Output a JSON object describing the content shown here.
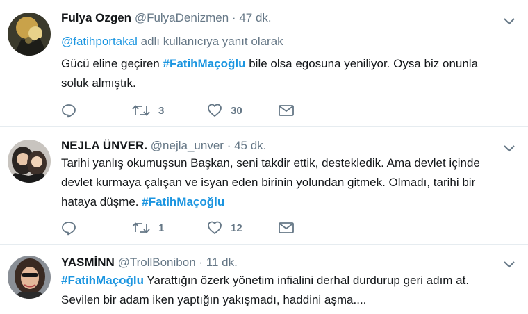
{
  "tweets": [
    {
      "name": "Fulya Ozgen",
      "handle": "@FulyaDenizmen",
      "separator": "·",
      "time": "47 dk.",
      "reply_mention": "@fatihportakal",
      "reply_suffix": "adlı kullanıcıya yanıt olarak",
      "line1_pre": "Gücü eline geçiren ",
      "line1_hashtag": "#FatihMaçoğlu",
      "line1_post": " bile olsa egosuna yeniliyor. Oysa biz onunla",
      "line2": "soluk almıştık.",
      "retweets": "3",
      "likes": "30",
      "avatar_icon": "user-avatar"
    },
    {
      "name": "NEJLA ÜNVER.",
      "handle": "@nejla_unver",
      "separator": "·",
      "time": "45 dk.",
      "line1": "Tarihi yanlış okumuşsun Başkan, seni takdir ettik, destekledik. Ama devlet içinde",
      "line2": "devlet kurmaya çalışan ve isyan eden birinin yolundan gitmek. Olmadı, tarihi bir",
      "line3_pre": "hataya düşme. ",
      "line3_hashtag": "#FatihMaçoğlu",
      "retweets": "1",
      "likes": "12",
      "avatar_icon": "user-avatar"
    },
    {
      "name": "YASMİNN",
      "handle": "@TrollBonibon",
      "separator": "·",
      "time": "11 dk.",
      "line1_hashtag": "#FatihMaçoğlu",
      "line1_post": " Yarattığın özerk yönetim infialini derhal durdurup geri adım at.",
      "line2": "Sevilen bir adam iken yaptığın yakışmadı, haddini aşma....",
      "avatar_icon": "user-avatar"
    }
  ],
  "colors": {
    "link": "#1b95e0",
    "muted": "#657786",
    "text": "#14171a",
    "divider": "#e6ecf0"
  },
  "icons": [
    "reply-icon",
    "retweet-icon",
    "like-icon",
    "message-icon",
    "chevron-down-icon"
  ]
}
